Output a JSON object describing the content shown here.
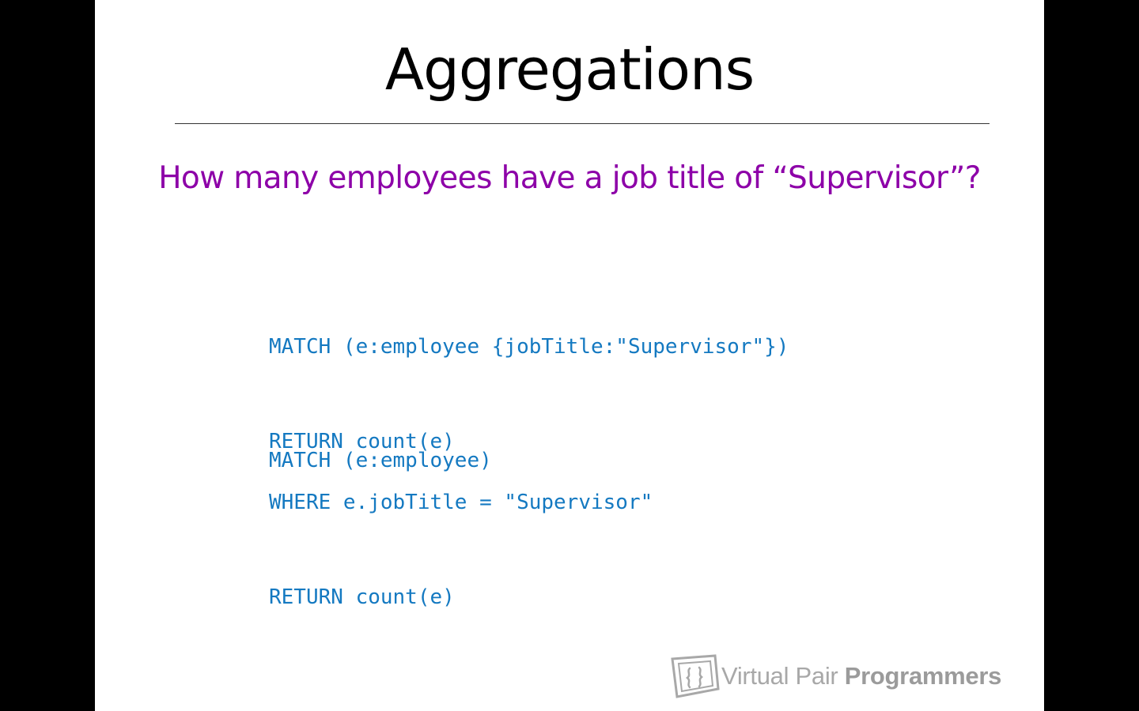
{
  "slide": {
    "title": "Aggregations",
    "question": "How many employees have a job title of “Supervisor”?",
    "code_block_1": [
      "MATCH (e:employee {jobTitle:\"Supervisor\"})",
      "RETURN count(e)"
    ],
    "code_block_2": [
      "MATCH (e:employee)"
    ],
    "code_block_3": [
      "WHERE e.jobTitle = \"Supervisor\"",
      "RETURN count(e)"
    ]
  },
  "logo": {
    "text_light": "Virtual Pair ",
    "text_bold": "Programmers",
    "icon": "vpp-logo-icon"
  },
  "colors": {
    "question": "#8d00a8",
    "code": "#1479c1",
    "logo": "#a8a8a8"
  }
}
